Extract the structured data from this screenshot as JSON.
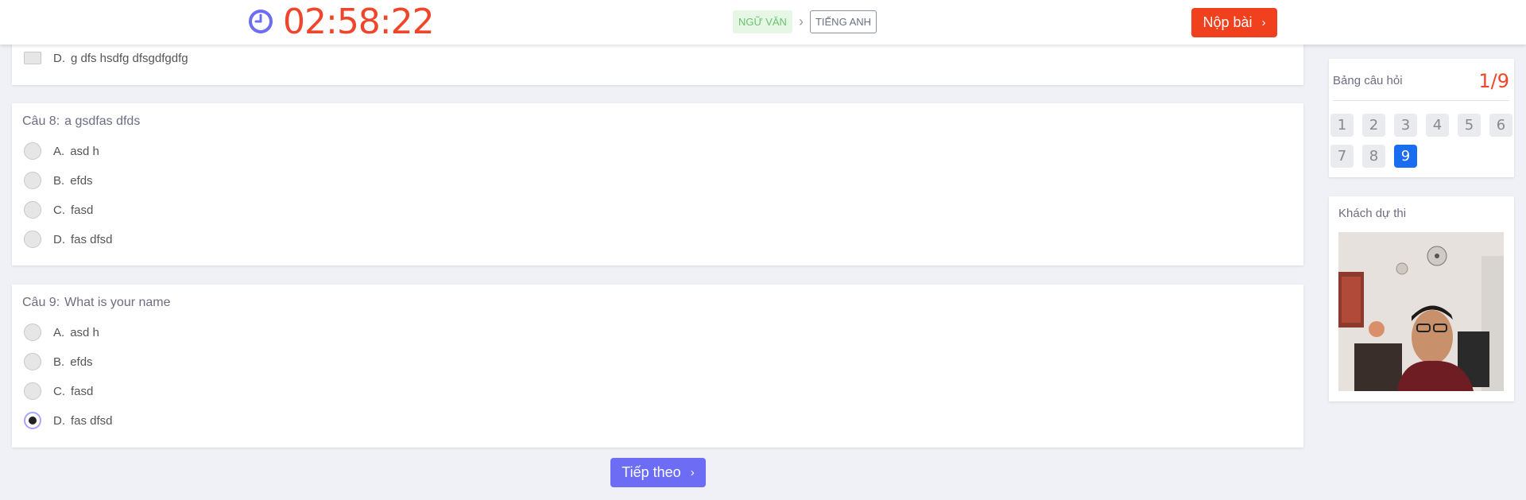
{
  "header": {
    "timer": "02:58:22",
    "subjects": {
      "current": "NGỮ VĂN",
      "next": "TIẾNG ANH"
    },
    "submit_label": "Nộp bài"
  },
  "questions": [
    {
      "option": {
        "letter": "D.",
        "text": "g dfs hsdfg dfsgdfgdfg"
      }
    },
    {
      "label": "Câu 8:",
      "text": "a gsdfas dfds",
      "options": [
        {
          "letter": "A.",
          "text": "asd h"
        },
        {
          "letter": "B.",
          "text": "efds"
        },
        {
          "letter": "C.",
          "text": "fasd"
        },
        {
          "letter": "D.",
          "text": "fas dfsd"
        }
      ]
    },
    {
      "label": "Câu 9:",
      "text": "What is your name",
      "options": [
        {
          "letter": "A.",
          "text": "asd h"
        },
        {
          "letter": "B.",
          "text": "efds"
        },
        {
          "letter": "C.",
          "text": "fasd"
        },
        {
          "letter": "D.",
          "text": "fas dfsd",
          "selected": true
        }
      ]
    }
  ],
  "next_label": "Tiếp theo",
  "question_panel": {
    "title": "Bảng câu hỏi",
    "count": "1/9",
    "numbers": [
      "1",
      "2",
      "3",
      "4",
      "5",
      "6",
      "7",
      "8",
      "9"
    ],
    "active": "9"
  },
  "candidate_panel": {
    "title": "Khách dự thi"
  },
  "colors": {
    "accent": "#6c6cf5",
    "danger": "#f0401e",
    "primary": "#1a6df0"
  }
}
